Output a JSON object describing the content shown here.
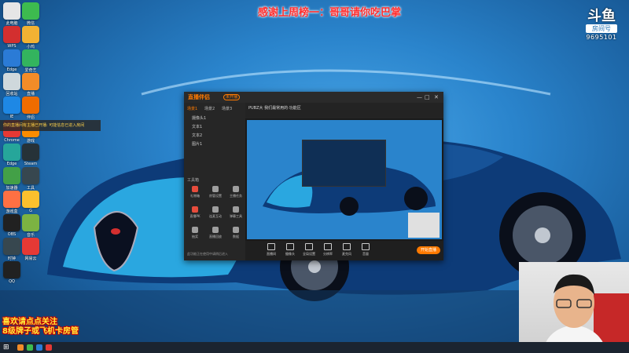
{
  "banner": "感谢上周榜一：哥哥请你吃巴掌",
  "logo": {
    "mark": "斗鱼",
    "tag": "房间号",
    "room_id": "9695101"
  },
  "notice": "你的直播间有主播已开播: 可能信息已进入房间",
  "footer": {
    "line1": "喜欢请点点关注",
    "line2": "8级牌子或飞机卡房管"
  },
  "desktop_icons": [
    {
      "label": "此电脑",
      "color": "#e6e6e6"
    },
    {
      "label": "微信",
      "color": "#3dbb4f"
    },
    {
      "label": "WPS",
      "color": "#d32f2f"
    },
    {
      "label": "小鸡",
      "color": "#f2b233"
    },
    {
      "label": "Edge",
      "color": "#2b7bd6"
    },
    {
      "label": "爱奇艺",
      "color": "#33b45e"
    },
    {
      "label": "回收站",
      "color": "#cfd8dc"
    },
    {
      "label": "直播",
      "color": "#f28c28"
    },
    {
      "label": "IE",
      "color": "#1e88e5"
    },
    {
      "label": "伴侣",
      "color": "#ef6c00"
    },
    {
      "label": "Chrome",
      "color": "#e53935"
    },
    {
      "label": "游戏",
      "color": "#fb8c00"
    },
    {
      "label": "Edge",
      "color": "#26a69a"
    },
    {
      "label": "Steam",
      "color": "#263238"
    },
    {
      "label": "加速器",
      "color": "#43a047"
    },
    {
      "label": "工具",
      "color": "#37474f"
    },
    {
      "label": "游戏盒",
      "color": "#ff7043"
    },
    {
      "label": "G",
      "color": "#fbc02d"
    },
    {
      "label": "OBS",
      "color": "#212121"
    },
    {
      "label": "音乐",
      "color": "#7cb342"
    },
    {
      "label": "时钟",
      "color": "#37474f"
    },
    {
      "label": "网易云",
      "color": "#e53935"
    },
    {
      "label": "QQ",
      "color": "#212121"
    }
  ],
  "app": {
    "title": "直播伴侣",
    "badge": "未开播",
    "side_tabs": [
      "场景1",
      "场景2",
      "场景3"
    ],
    "scenes": [
      "摄像头1",
      "文本1",
      "文本2",
      "图片1"
    ],
    "tools_label": "工具箱",
    "tools": [
      {
        "label": "礼物箱",
        "color": "#e74c3c"
      },
      {
        "label": "房管设置",
        "color": "#9e9e9e"
      },
      {
        "label": "主播任务",
        "color": "#9e9e9e"
      },
      {
        "label": "直播PK",
        "color": "#e74c3c"
      },
      {
        "label": "连麦互动",
        "color": "#9e9e9e"
      },
      {
        "label": "弹幕工具",
        "color": "#9e9e9e"
      },
      {
        "label": "抽奖",
        "color": "#9e9e9e"
      },
      {
        "label": "直播回放",
        "color": "#9e9e9e"
      },
      {
        "label": "数据",
        "color": "#9e9e9e"
      }
    ],
    "footer_text": "此功能正在使用中请稍后进入",
    "room_title": "PUBZ大 我们最常用的·功能区",
    "actions": [
      "直播间",
      "摄像头",
      "全局设置",
      "分辨率",
      "麦克风",
      "音量"
    ],
    "go_live": "开始直播"
  },
  "taskbar_colors": [
    "#f28c28",
    "#3dbb4f",
    "#2b7bd6",
    "#e53935"
  ]
}
